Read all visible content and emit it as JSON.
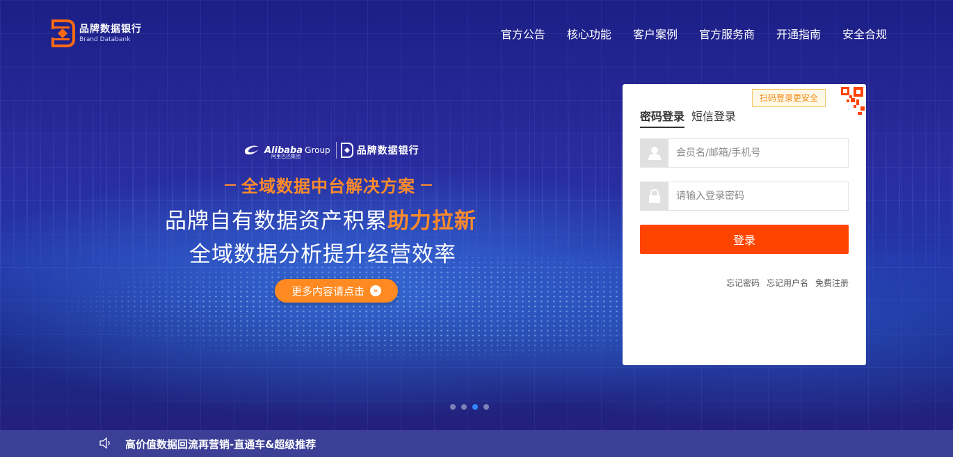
{
  "header": {
    "logo_cn": "品牌数据银行",
    "logo_en": "Brand Databank",
    "nav": [
      "官方公告",
      "核心功能",
      "客户案例",
      "官方服务商",
      "开通指南",
      "安全合规"
    ]
  },
  "banner": {
    "partner_logo": "Alibaba",
    "partner_group": "Group",
    "partner_sub": "阿里巴巴集团",
    "partner_name": "品牌数据银行",
    "tagline": "全域数据中台解决方案",
    "headline1_main": "品牌自有数据资产积累",
    "headline1_highlight": "助力拉新",
    "headline2": "全域数据分析提升经营效率",
    "more_button": "更多内容请点击",
    "pager": {
      "count": 4,
      "active": 3
    }
  },
  "login": {
    "qr_tip": "扫码登录更安全",
    "tabs": [
      "密码登录",
      "短信登录"
    ],
    "active_tab": 0,
    "username_placeholder": "会员名/邮箱/手机号",
    "password_placeholder": "请输入登录密码",
    "submit_label": "登录",
    "links": [
      "忘记密码",
      "忘记用户名",
      "免费注册"
    ]
  },
  "notice": {
    "icon": "speaker-icon",
    "text": "高价值数据回流再营销-直通车&超级推荐"
  },
  "colors": {
    "accent_orange": "#ff8b2b",
    "login_button": "#ff4400",
    "pager_active": "#2f86ff"
  }
}
